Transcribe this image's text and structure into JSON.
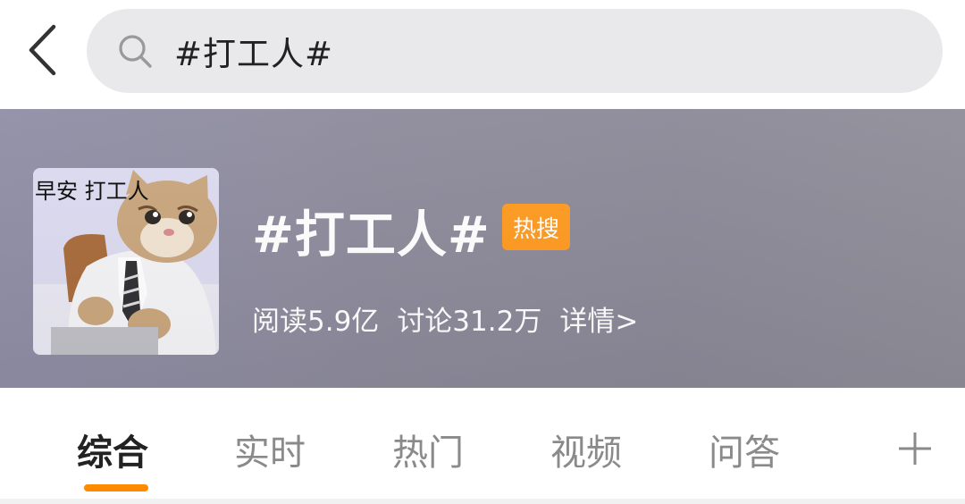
{
  "search": {
    "query": "#打工人#"
  },
  "topic": {
    "cover_caption": "早安 打工人",
    "title": "#打工人#",
    "badge": "热搜",
    "reads": "阅读5.9亿",
    "discussions": "讨论31.2万",
    "details": "详情>"
  },
  "tabs": [
    {
      "label": "综合",
      "active": true
    },
    {
      "label": "实时"
    },
    {
      "label": "热门"
    },
    {
      "label": "视频"
    },
    {
      "label": "问答"
    }
  ],
  "icons": {
    "back": "chevron-left-icon",
    "search": "search-icon",
    "add": "plus-icon"
  },
  "colors": {
    "accent": "#ff8a00",
    "badge": "#ff9a1f"
  }
}
